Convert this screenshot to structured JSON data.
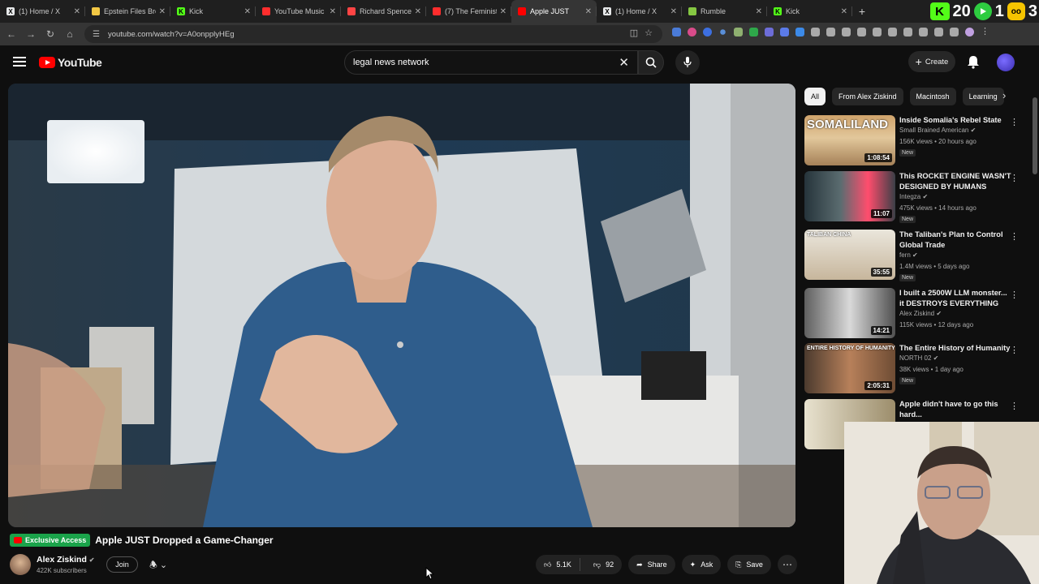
{
  "browser": {
    "tabs": [
      {
        "title": "(1) Home / X",
        "fav": "X",
        "favColor": "#e7e9ea"
      },
      {
        "title": "Epstein Files Bro",
        "fav": "",
        "favColor": "#f2c744"
      },
      {
        "title": "Kick",
        "fav": "K",
        "favColor": "#53fc18"
      },
      {
        "title": "YouTube Music",
        "fav": "",
        "favColor": "#ff2d2d"
      },
      {
        "title": "Richard Spencer",
        "fav": "",
        "favColor": "#ff4444"
      },
      {
        "title": "(7) The Feminist",
        "fav": "",
        "favColor": "#ff2d2d"
      },
      {
        "title": "Apple JUST",
        "fav": "",
        "favColor": "#ff0000"
      },
      {
        "title": "(1) Home / X",
        "fav": "X",
        "favColor": "#e7e9ea"
      },
      {
        "title": "Rumble",
        "fav": "",
        "favColor": "#85c742"
      },
      {
        "title": "Kick",
        "fav": "K",
        "favColor": "#53fc18"
      }
    ],
    "active_tab": 6,
    "url": "youtube.com/watch?v=A0onpplyHEg",
    "overlay_digits": [
      "20",
      "1",
      "3"
    ]
  },
  "youtube": {
    "logo": "YouTube",
    "search_value": "legal news network",
    "create_label": "Create"
  },
  "video": {
    "badge": "Exclusive Access",
    "title": "Apple JUST Dropped a Game-Changer",
    "channel": "Alex Ziskind",
    "subscribers": "422K subscribers",
    "join_label": "Join",
    "likes": "5.1K",
    "dislikes": "92",
    "share_label": "Share",
    "ask_label": "Ask",
    "save_label": "Save"
  },
  "chips": [
    "All",
    "From Alex Ziskind",
    "Macintosh",
    "Learning"
  ],
  "recommendations": [
    {
      "title": "Inside Somalia's Rebel State",
      "channel": "Small Brained American",
      "meta": "156K views • 20 hours ago",
      "duration": "1:08:54",
      "new": "New",
      "thumb_text": "SOMALILAND"
    },
    {
      "title": "This ROCKET ENGINE WASN'T DESIGNED BY HUMANS",
      "channel": "Integza",
      "meta": "475K views • 14 hours ago",
      "duration": "11:07",
      "new": "New",
      "thumb_text": ""
    },
    {
      "title": "The Taliban's Plan to Control Global Trade",
      "channel": "fern",
      "meta": "1.4M views • 5 days ago",
      "duration": "35:55",
      "new": "New",
      "thumb_text": "TALIBAN   CHINA"
    },
    {
      "title": "I built a 2500W LLM monster... it DESTROYS EVERYTHING",
      "channel": "Alex Ziskind",
      "meta": "115K views • 12 days ago",
      "duration": "14:21",
      "new": "",
      "thumb_text": ""
    },
    {
      "title": "The Entire History of Humanity",
      "channel": "NORTH 02",
      "meta": "38K views • 1 day ago",
      "duration": "2:05:31",
      "new": "New",
      "thumb_text": "ENTIRE HISTORY OF HUMANITY"
    },
    {
      "title": "Apple didn't have to go this hard...",
      "channel": "",
      "meta": "",
      "duration": "",
      "new": "",
      "thumb_text": ""
    }
  ],
  "colors": {
    "yt_red": "#ff0000",
    "badge_green": "#1aa34a",
    "kick_green": "#53fc18"
  }
}
